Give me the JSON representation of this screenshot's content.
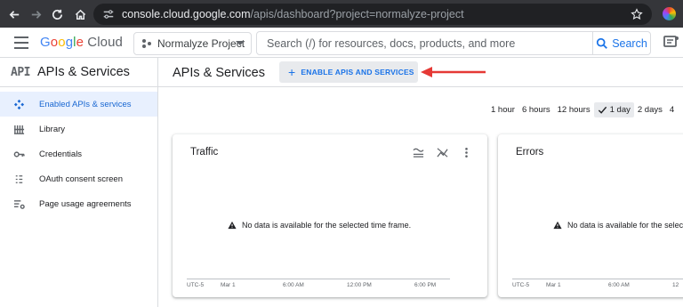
{
  "browser": {
    "url_domain": "console.cloud.google.com",
    "url_path": "/apis/dashboard?project=normalyze-project"
  },
  "topbar": {
    "logo": "Google Cloud",
    "project": "Normalyze Project",
    "search_placeholder": "Search (/) for resources, docs, products, and more",
    "search_button": "Search"
  },
  "sidebar": {
    "header": "APIs & Services",
    "logo_text": "API",
    "items": [
      {
        "label": "Enabled APIs & services",
        "icon": "api-diamond-icon",
        "active": true
      },
      {
        "label": "Library",
        "icon": "library-icon"
      },
      {
        "label": "Credentials",
        "icon": "key-icon"
      },
      {
        "label": "OAuth consent screen",
        "icon": "consent-icon"
      },
      {
        "label": "Page usage agreements",
        "icon": "settings-list-icon"
      }
    ]
  },
  "main": {
    "title": "APIs & Services",
    "enable_button": "ENABLE APIS AND SERVICES",
    "annotation_color": "#e53935"
  },
  "time_ranges": [
    "1 hour",
    "6 hours",
    "12 hours",
    "1 day",
    "2 days",
    "4"
  ],
  "time_selected": "1 day",
  "cards": {
    "traffic": {
      "title": "Traffic",
      "no_data": "No data is available for the selected time frame.",
      "timezone": "UTC-5",
      "ticks": [
        "Mar 1",
        "6:00 AM",
        "12:00 PM",
        "6:00 PM"
      ]
    },
    "errors": {
      "title": "Errors",
      "no_data": "No data is available for the selecte",
      "timezone": "UTC-5",
      "ticks": [
        "Mar 1",
        "6:00 AM",
        "12"
      ]
    }
  }
}
